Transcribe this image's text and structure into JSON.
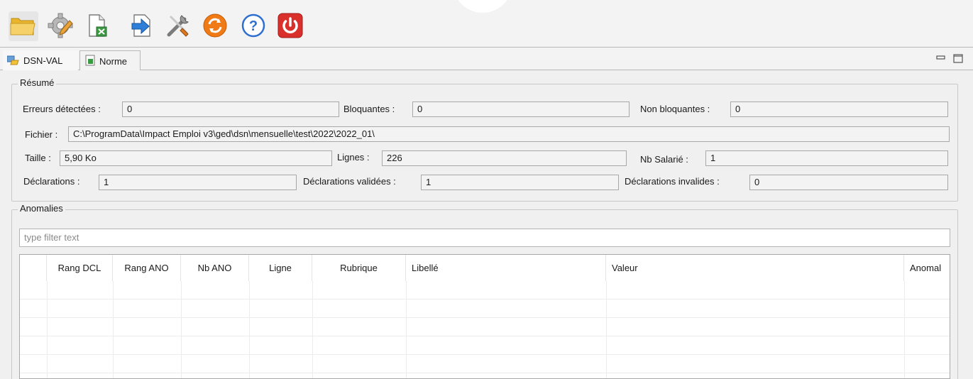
{
  "toolbar": {
    "buttons": [
      {
        "icon": "folder-open-icon"
      },
      {
        "icon": "settings-gear-icon"
      },
      {
        "icon": "export-sheet-icon"
      },
      {
        "icon": "import-arrow-icon"
      },
      {
        "icon": "tools-icon"
      },
      {
        "icon": "refresh-icon"
      },
      {
        "icon": "help-icon"
      },
      {
        "icon": "power-icon"
      }
    ]
  },
  "tabs": [
    {
      "label": "DSN-VAL",
      "icon": "dsn-val-icon",
      "selected": true
    },
    {
      "label": "Norme",
      "icon": "norme-doc-icon",
      "selected": false
    }
  ],
  "resume": {
    "title": "Résumé",
    "erreurs_label": "Erreurs détectées :",
    "erreurs_value": "0",
    "bloquantes_label": "Bloquantes :",
    "bloquantes_value": "0",
    "non_bloquantes_label": "Non bloquantes :",
    "non_bloquantes_value": "0",
    "fichier_label": "Fichier :",
    "fichier_value": "C:\\ProgramData\\Impact Emploi v3\\ged\\dsn\\mensuelle\\test\\2022\\2022_01\\",
    "taille_label": "Taille :",
    "taille_value": "5,90 Ko",
    "lignes_label": "Lignes :",
    "lignes_value": "226",
    "nb_salarie_label": "Nb Salarié :",
    "nb_salarie_value": "1",
    "declarations_label": "Déclarations :",
    "declarations_value": "1",
    "declarations_validees_label": "Déclarations validées :",
    "declarations_validees_value": "1",
    "declarations_invalides_label": "Déclarations invalides :",
    "declarations_invalides_value": "0"
  },
  "anomalies": {
    "title": "Anomalies",
    "filter_placeholder": "type filter text",
    "columns": [
      "",
      "Rang DCL",
      "Rang ANO",
      "Nb ANO",
      "Ligne",
      "Rubrique",
      "Libellé",
      "Valeur",
      "Anomal"
    ],
    "rows": []
  },
  "colors": {
    "power_red": "#d9302c",
    "help_blue": "#2f6fd0",
    "refresh_orange": "#f07a16",
    "folder_yellow": "#f2c23a"
  }
}
